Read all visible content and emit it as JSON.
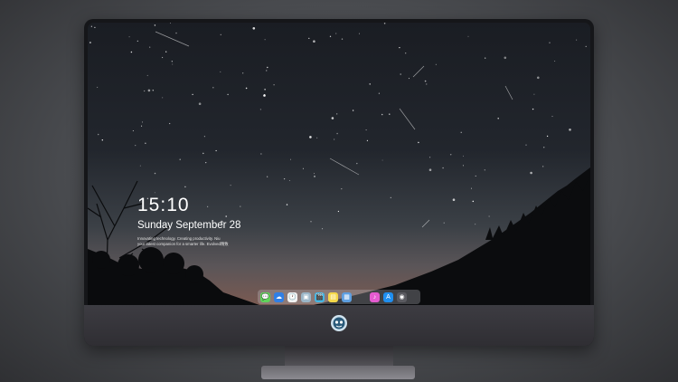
{
  "lockscreen": {
    "time": "15:10",
    "date": "Sunday September 28",
    "tagline_line1": "Innovating technology. Creating productivity. Niu",
    "tagline_line2": "your latest companion for a smarter life. Evolved精致"
  },
  "dock": {
    "apps": [
      {
        "name": "messages-icon",
        "color": "#5fd35b",
        "glyph": "💬"
      },
      {
        "name": "finder-icon",
        "color": "#2f7fe6",
        "glyph": "☁"
      },
      {
        "name": "clock-app-icon",
        "color": "#f2f2f2",
        "glyph": "🕐"
      },
      {
        "name": "preview-icon",
        "color": "#9bb6c8",
        "glyph": "▣"
      },
      {
        "name": "video-icon",
        "color": "#45b6e4",
        "glyph": "🎬"
      },
      {
        "name": "notes-icon",
        "color": "#f6d84a",
        "glyph": "▤"
      },
      {
        "name": "photos-icon",
        "color": "#5e9fe0",
        "glyph": "▦"
      },
      {
        "name": "itunes-icon",
        "color": "#e45bd0",
        "glyph": "♪"
      },
      {
        "name": "app-store-icon",
        "color": "#1f8ff0",
        "glyph": "A"
      },
      {
        "name": "camera-icon",
        "color": "#5a5a60",
        "glyph": "◉"
      }
    ]
  }
}
